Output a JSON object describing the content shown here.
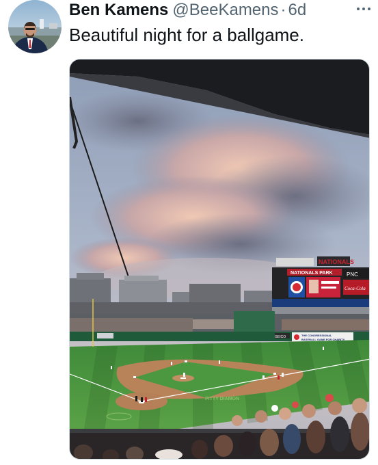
{
  "tweet": {
    "author_name": "Ben Kamens",
    "author_handle": "@BeeKamens",
    "separator": "·",
    "time": "6d",
    "text": "Beautiful night for a ballgame."
  },
  "photo": {
    "signs": {
      "top_banner": "NATIONALS PARK",
      "sponsor_right": "PNC",
      "sponsor_cola": "Coca-Cola",
      "red_lettering": "NATIONALS",
      "congressional": "THE CONGRESSIONAL BASEBALL GAME FOR CHARITY",
      "left_sponsor": "GEICO",
      "field_text": "PITTY DIAMON"
    }
  },
  "icons": {
    "more": "more-options-icon"
  }
}
